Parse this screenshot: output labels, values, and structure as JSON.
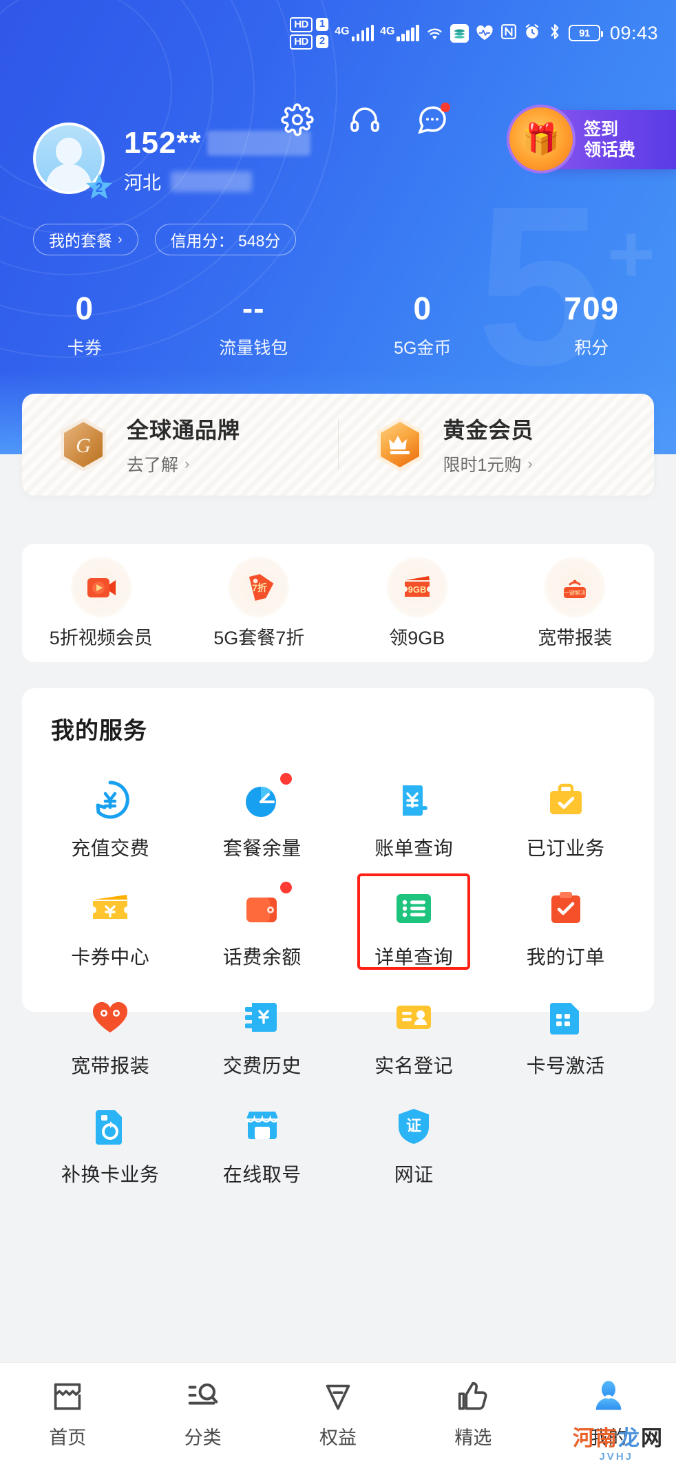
{
  "status_bar": {
    "hd_label_1": "HD",
    "sim_1": "1",
    "hd_label_2": "HD",
    "sim_2": "2",
    "network_1": "4G",
    "network_2": "4G",
    "wifi_icon": "wifi-icon",
    "app_icon": "china-mobile-app-icon",
    "health_icon": "heart-rate-icon",
    "nfc_icon": "nfc-icon",
    "alarm_icon": "alarm-icon",
    "bluetooth_icon": "bluetooth-icon",
    "battery_level": "91",
    "time": "09:43"
  },
  "header": {
    "settings_icon": "gear-icon",
    "support_icon": "headset-icon",
    "message_icon": "chat-bubble-icon",
    "message_has_badge": true,
    "signin": {
      "gift_icon": "gift-box-icon",
      "line1": "签到",
      "line2": "领话费"
    }
  },
  "profile": {
    "avatar_icon": "default-avatar-icon",
    "level": "2",
    "phone_masked": "152**",
    "region": "河北",
    "chips": [
      {
        "label": "我的套餐",
        "chevron": "›"
      },
      {
        "label": "信用分： 548分"
      }
    ]
  },
  "stats": [
    {
      "value": "0",
      "label": "卡券"
    },
    {
      "value": "--",
      "label": "流量钱包"
    },
    {
      "value": "0",
      "label": "5G金币"
    },
    {
      "value": "709",
      "label": "积分"
    }
  ],
  "brand_card": [
    {
      "icon": "globaltone-hex-icon",
      "title": "全球通品牌",
      "sub": "去了解",
      "chevron": "›"
    },
    {
      "icon": "crown-hex-icon",
      "title": "黄金会员",
      "sub": "限时1元购",
      "chevron": "›"
    }
  ],
  "promos": [
    {
      "icon": "video-player-icon",
      "label": "5折视频会员",
      "badge": ""
    },
    {
      "icon": "price-tag-icon",
      "label": "5G套餐7折",
      "badge": "7折"
    },
    {
      "icon": "data-coupon-icon",
      "label": "领9GB",
      "badge": "9GB"
    },
    {
      "icon": "broadband-router-icon",
      "label": "宽带报装",
      "badge": "一键解决"
    }
  ],
  "services": {
    "title": "我的服务",
    "items": [
      {
        "icon": "recharge-yen-icon",
        "label": "充值交费",
        "badge": false,
        "highlighted": false
      },
      {
        "icon": "pie-chart-icon",
        "label": "套餐余量",
        "badge": true,
        "highlighted": false
      },
      {
        "icon": "bill-yen-icon",
        "label": "账单查询",
        "badge": false,
        "highlighted": false
      },
      {
        "icon": "briefcase-check-icon",
        "label": "已订业务",
        "badge": false,
        "highlighted": false
      },
      {
        "icon": "coupon-ticket-icon",
        "label": "卡券中心",
        "badge": false,
        "highlighted": false
      },
      {
        "icon": "wallet-icon",
        "label": "话费余额",
        "badge": true,
        "highlighted": false
      },
      {
        "icon": "list-detail-icon",
        "label": "详单查询",
        "badge": false,
        "highlighted": true
      },
      {
        "icon": "clipboard-check-icon",
        "label": "我的订单",
        "badge": false,
        "highlighted": false
      },
      {
        "icon": "broadband-heart-icon",
        "label": "宽带报装",
        "badge": false,
        "highlighted": false
      },
      {
        "icon": "payment-history-icon",
        "label": "交费历史",
        "badge": false,
        "highlighted": false
      },
      {
        "icon": "id-card-icon",
        "label": "实名登记",
        "badge": false,
        "highlighted": false
      },
      {
        "icon": "sim-card-icon",
        "label": "卡号激活",
        "badge": false,
        "highlighted": false
      },
      {
        "icon": "sim-replace-icon",
        "label": "补换卡业务",
        "badge": false,
        "highlighted": false
      },
      {
        "icon": "store-icon",
        "label": "在线取号",
        "badge": false,
        "highlighted": false
      },
      {
        "icon": "shield-cert-icon",
        "label": "网证",
        "badge": false,
        "highlighted": false
      }
    ]
  },
  "tabbar": [
    {
      "icon": "home-icon",
      "label": "首页",
      "active": false
    },
    {
      "icon": "category-search-icon",
      "label": "分类",
      "active": false
    },
    {
      "icon": "benefits-tag-icon",
      "label": "权益",
      "active": false
    },
    {
      "icon": "thumbs-up-icon",
      "label": "精选",
      "active": false
    },
    {
      "icon": "person-icon",
      "label": "我的",
      "active": true
    }
  ],
  "watermark": {
    "c1": "河南",
    "c2": "龙",
    "c3": "网",
    "sub": "JVHJ"
  },
  "colors": {
    "header_blue": "#3366ef",
    "accent_orange": "#f2761f",
    "highlight_red": "#ff2116",
    "badge_red": "#ff3b34",
    "active_blue": "#3ba0f5"
  }
}
